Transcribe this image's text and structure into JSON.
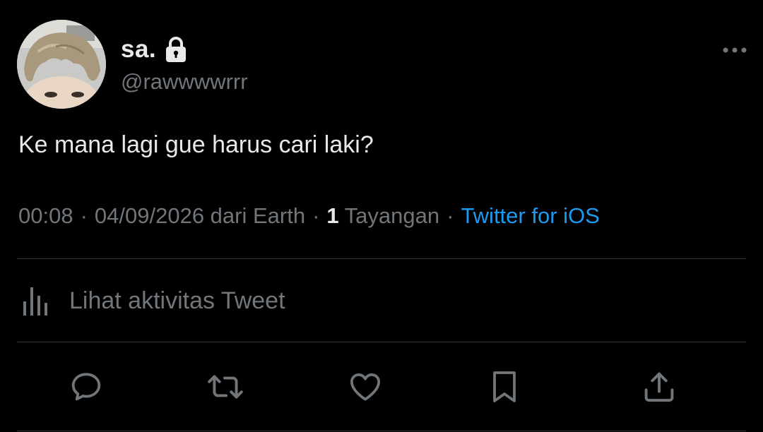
{
  "user": {
    "display_name": "sa.",
    "handle": "@rawwwwrrr",
    "protected_icon": "lock-icon",
    "avatar_icon": "profile-photo"
  },
  "tweet": {
    "text": "Ke mana lagi gue harus cari laki?",
    "time": "00:08",
    "separator": "·",
    "date": "04/09/2026 dari Earth",
    "views_count": "1",
    "views_label": "Tayangan",
    "source": "Twitter for iOS"
  },
  "activity": {
    "label": "Lihat aktivitas Tweet",
    "icon": "bar-chart-icon"
  },
  "actions": [
    {
      "name": "reply",
      "icon": "reply-icon"
    },
    {
      "name": "retweet",
      "icon": "retweet-icon"
    },
    {
      "name": "like",
      "icon": "heart-icon"
    },
    {
      "name": "bookmark",
      "icon": "bookmark-icon"
    },
    {
      "name": "share",
      "icon": "share-icon"
    }
  ],
  "more_icon": "more-icon",
  "colors": {
    "background": "#000000",
    "primary_text": "#e7e9ea",
    "secondary_text": "#71767b",
    "link": "#1d9bf0",
    "divider": "#2f3336"
  }
}
